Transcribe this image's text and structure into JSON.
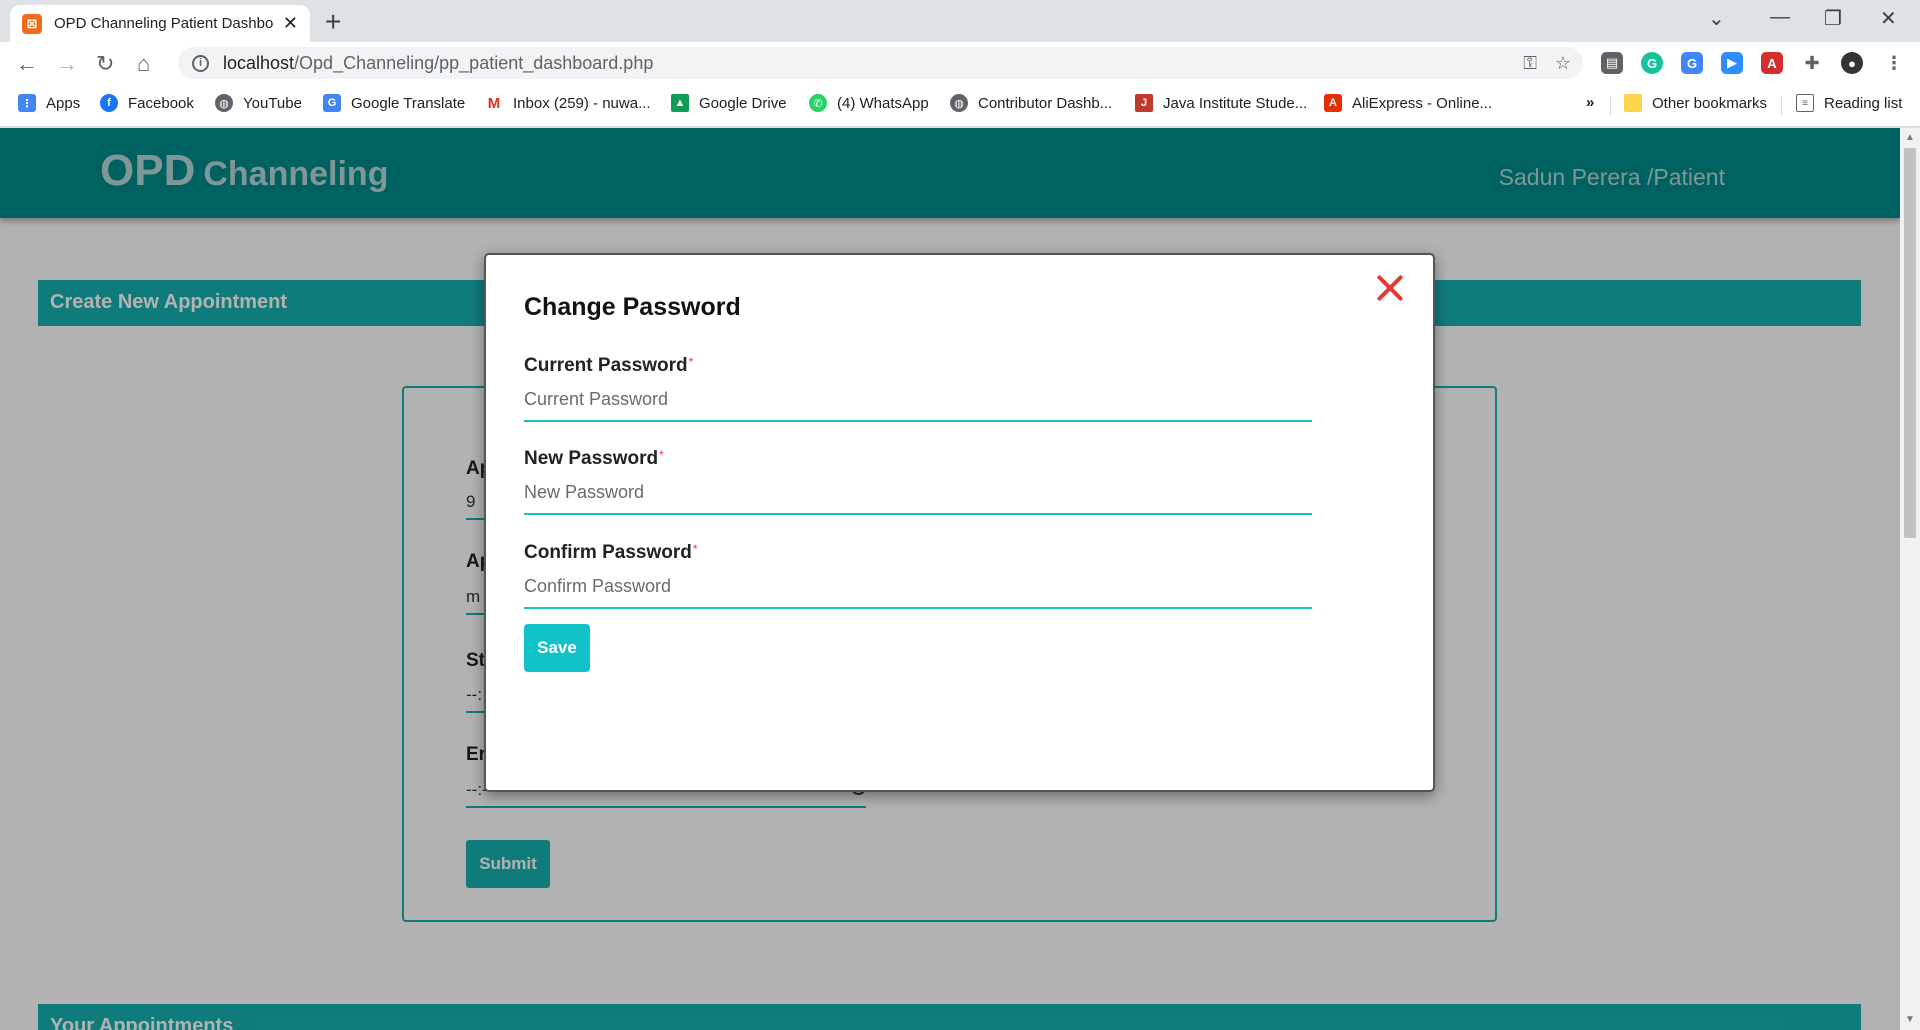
{
  "browser": {
    "tab_title": "OPD Channeling Patient Dashboard",
    "tab_favicon": "xampp-icon",
    "url_host": "localhost",
    "url_path": "/Opd_Channeling/pp_patient_dashboard.php",
    "bookmarks": [
      {
        "label": "Apps",
        "icon": "apps-grid-icon",
        "color": "#4285f4"
      },
      {
        "label": "Facebook",
        "icon": "facebook-icon",
        "color": "#1877f2"
      },
      {
        "label": "YouTube",
        "icon": "globe-icon",
        "color": "#5f6368"
      },
      {
        "label": "Google Translate",
        "icon": "translate-icon",
        "color": "#4285f4"
      },
      {
        "label": "Inbox (259) - nuwa...",
        "icon": "gmail-icon",
        "color": "#d93025"
      },
      {
        "label": "Google Drive",
        "icon": "drive-icon",
        "color": "#0f9d58"
      },
      {
        "label": "(4) WhatsApp",
        "icon": "whatsapp-icon",
        "color": "#25d366"
      },
      {
        "label": "Contributor Dashb...",
        "icon": "globe-icon",
        "color": "#5f6368"
      },
      {
        "label": "Java Institute Stude...",
        "icon": "java-icon",
        "color": "#c0392b"
      },
      {
        "label": "AliExpress - Online...",
        "icon": "aliexpress-icon",
        "color": "#e62e04"
      }
    ],
    "other_bookmarks": "Other bookmarks",
    "reading_list": "Reading list",
    "overflow": "»"
  },
  "header": {
    "brand_big": "OPD",
    "brand_small": "Channeling",
    "user": "Sadun Perera /Patient"
  },
  "sections": {
    "create": "Create New Appointment",
    "appointments": "Your Appointments"
  },
  "background_form": {
    "fields": [
      {
        "label": "Ap",
        "value": "9"
      },
      {
        "label": "Ap",
        "value": "m"
      },
      {
        "label": "St",
        "value": "--:"
      },
      {
        "label": "Er",
        "value": "--:-- --"
      }
    ],
    "submit": "Submit"
  },
  "modal": {
    "title": "Change Password",
    "required_mark": "*",
    "fields": [
      {
        "label": "Current Password",
        "placeholder": "Current Password"
      },
      {
        "label": "New Password",
        "placeholder": "New Password"
      },
      {
        "label": "Confirm Password",
        "placeholder": "Confirm Password"
      }
    ],
    "save": "Save"
  },
  "colors": {
    "primary": "#008b8b",
    "accent": "#17b1b1",
    "close": "#e53935"
  }
}
